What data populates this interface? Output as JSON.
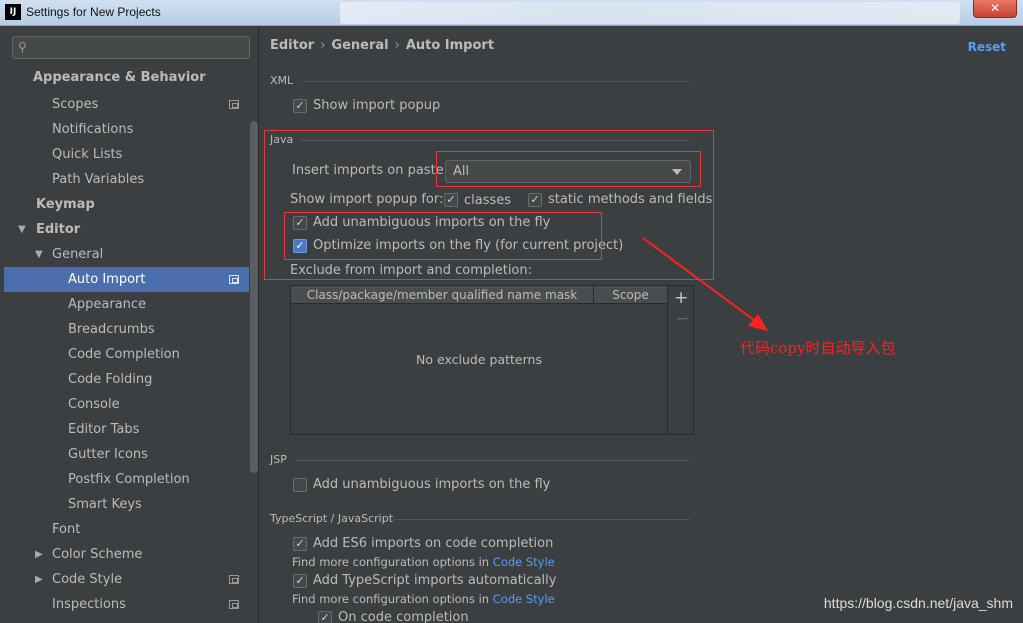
{
  "window": {
    "title": "Settings for New Projects",
    "app_icon": "IJ",
    "close_glyph": "✕"
  },
  "search": {
    "placeholder": ""
  },
  "sidebar": {
    "items": [
      {
        "label": "Appearance & Behavior"
      },
      {
        "label": "Scopes"
      },
      {
        "label": "Notifications"
      },
      {
        "label": "Quick Lists"
      },
      {
        "label": "Path Variables"
      },
      {
        "label": "Keymap"
      },
      {
        "label": "Editor"
      },
      {
        "label": "General"
      },
      {
        "label": "Auto Import"
      },
      {
        "label": "Appearance"
      },
      {
        "label": "Breadcrumbs"
      },
      {
        "label": "Code Completion"
      },
      {
        "label": "Code Folding"
      },
      {
        "label": "Console"
      },
      {
        "label": "Editor Tabs"
      },
      {
        "label": "Gutter Icons"
      },
      {
        "label": "Postfix Completion"
      },
      {
        "label": "Smart Keys"
      },
      {
        "label": "Font"
      },
      {
        "label": "Color Scheme"
      },
      {
        "label": "Code Style"
      },
      {
        "label": "Inspections"
      }
    ]
  },
  "breadcrumb": {
    "part1": "Editor",
    "part2": "General",
    "part3": "Auto Import",
    "sep": "›"
  },
  "reset_label": "Reset",
  "xml": {
    "title": "XML",
    "show_popup": "Show import popup"
  },
  "java": {
    "title": "Java",
    "insert_label": "Insert imports on paste:",
    "insert_value": "All",
    "popup_for_label": "Show import popup for:",
    "classes": "classes",
    "static_methods": "static methods and fields",
    "unambiguous": "Add unambiguous imports on the fly",
    "optimize": "Optimize imports on the fly (for current project)",
    "exclude_label": "Exclude from import and completion:",
    "col_mask": "Class/package/member qualified name mask",
    "col_scope": "Scope",
    "empty": "No exclude patterns",
    "plus": "+",
    "minus": "−"
  },
  "jsp": {
    "title": "JSP",
    "unambiguous": "Add unambiguous imports on the fly"
  },
  "ts": {
    "title": "TypeScript / JavaScript",
    "es6": "Add ES6 imports on code completion",
    "find_more_1": "Find more configuration options in ",
    "code_style_1": "Code Style",
    "ts_auto": "Add TypeScript imports automatically",
    "find_more_2": "Find more configuration options in ",
    "code_style_2": "Code Style",
    "on_completion": "On code completion"
  },
  "annotation": "代码copy时自动导入包",
  "watermark": "https://blog.csdn.net/java_shm"
}
